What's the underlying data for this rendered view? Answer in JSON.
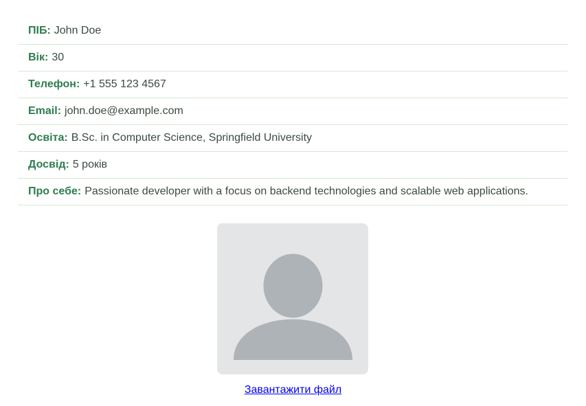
{
  "profile": {
    "fields": [
      {
        "label": "ПІБ:",
        "value": "John Doe"
      },
      {
        "label": "Вік:",
        "value": "30"
      },
      {
        "label": "Телефон:",
        "value": "+1 555 123 4567"
      },
      {
        "label": "Email:",
        "value": "john.doe@example.com"
      },
      {
        "label": "Освіта:",
        "value": "B.Sc. in Computer Science, Springfield University"
      },
      {
        "label": "Досвід:",
        "value": "5 років"
      },
      {
        "label": "Про себе:",
        "value": "Passionate developer with a focus on backend technologies and scalable web applications."
      }
    ]
  },
  "avatar": {
    "icon": "user-placeholder-icon",
    "background_color": "#e4e5e7",
    "silhouette_color": "#aeb3b7"
  },
  "upload": {
    "link_label": "Завантажити файл"
  },
  "colors": {
    "label": "#2e7d4f",
    "text": "#3a4a3f",
    "divider": "#d6e8d2",
    "link": "#0000ee"
  }
}
